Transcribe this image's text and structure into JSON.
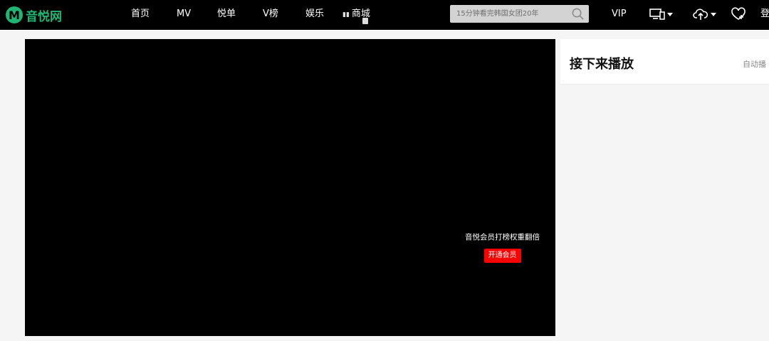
{
  "brand": {
    "logo_letter": "M",
    "name": "音悦网"
  },
  "nav": {
    "home": "首页",
    "mv": "MV",
    "playlist": "悦单",
    "vchart": "V榜",
    "entertainment": "娱乐",
    "shop": "商城"
  },
  "search": {
    "placeholder": "15分钟看完韩国女团20年"
  },
  "toolbar": {
    "vip": "VIP",
    "login_partial": "登"
  },
  "player": {
    "promo_text": "音悦会员打榜权重翻倍",
    "promo_button": "开通会员"
  },
  "sidebar": {
    "title": "接下来播放",
    "autoplay_label": "自动播"
  },
  "colors": {
    "brand_green": "#21b573",
    "promo_red": "#ff0000",
    "topbar": "#000000",
    "page_bg": "#f5f5f5"
  },
  "icons": [
    "search-icon",
    "device-icon",
    "upload-cloud-icon",
    "message-add-icon",
    "shop-icon"
  ]
}
